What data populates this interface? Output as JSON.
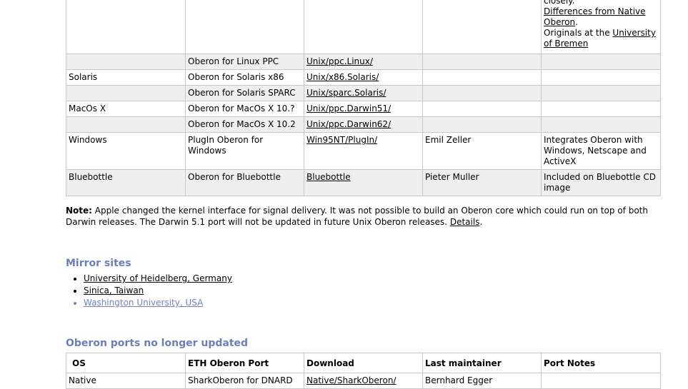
{
  "top_table": {
    "partial_row": {
      "notes_line1": "closely.",
      "notes_link1": "Differences from Native Oberon",
      "notes_after_link1": ".",
      "notes_text2": "Originals at the ",
      "notes_link2": "University of Bremen"
    },
    "rows": [
      {
        "os": "",
        "port": "Oberon for Linux PPC",
        "download": "Unix/ppc.Linux/",
        "maintainer": "",
        "notes": ""
      },
      {
        "os": "Solaris",
        "port": "Oberon for Solaris x86",
        "download": "Unix/x86.Solaris/",
        "maintainer": "",
        "notes": ""
      },
      {
        "os": "",
        "port": "Oberon for Solaris SPARC",
        "download": "Unix/sparc.Solaris/",
        "maintainer": "",
        "notes": ""
      },
      {
        "os": "MacOs X",
        "port": "Oberon for MacOs X 10.?",
        "download": "Unix/ppc.Darwin51/",
        "maintainer": "",
        "notes": ""
      },
      {
        "os": "",
        "port": "Oberon for MacOs X 10.2",
        "download": "Unix/ppc.Darwin62/",
        "maintainer": "",
        "notes": ""
      },
      {
        "os": "Windows",
        "port": "PlugIn Oberon for Windows",
        "download": "Win95NT/PlugIn/",
        "maintainer": "Emil Zeller",
        "notes": "Integrates Oberon with Windows, Netscape and ActiveX"
      },
      {
        "os": "Bluebottle",
        "port": "Oberon for Bluebottle",
        "download": "Bluebottle",
        "maintainer": "Pieter Muller",
        "notes": "Included on Bluebottle CD image"
      }
    ]
  },
  "note": {
    "label": "Note:",
    "text": " Apple changed the kernel interface for signal delivery. It was not possible to build an Oberon core which could run on top of both Darwin releases. The Darwin 5.1 port will not be updated in future Unix Oberon releases. ",
    "link": "Details",
    "end": "."
  },
  "mirrors": {
    "heading": "Mirror sites",
    "items": [
      "University of Heidelberg, Germany",
      "Sinica, Taiwan",
      "Washington University, USA"
    ],
    "visited_color": "#7482c4"
  },
  "old_ports": {
    "heading": "Oberon ports no longer updated",
    "headers": [
      "OS",
      "ETH Oberon Port",
      "Download",
      "Last maintainer",
      "Port Notes"
    ],
    "rows": [
      {
        "os": "Native",
        "port": "SharkOberon for DNARD",
        "download": "Native/SharkOberon/",
        "maintainer": "Bernhard Egger",
        "notes": ""
      }
    ]
  },
  "colors": {
    "heading": "#6b7fba",
    "row_shade": "#efefef",
    "border": "#c8c8c8"
  }
}
